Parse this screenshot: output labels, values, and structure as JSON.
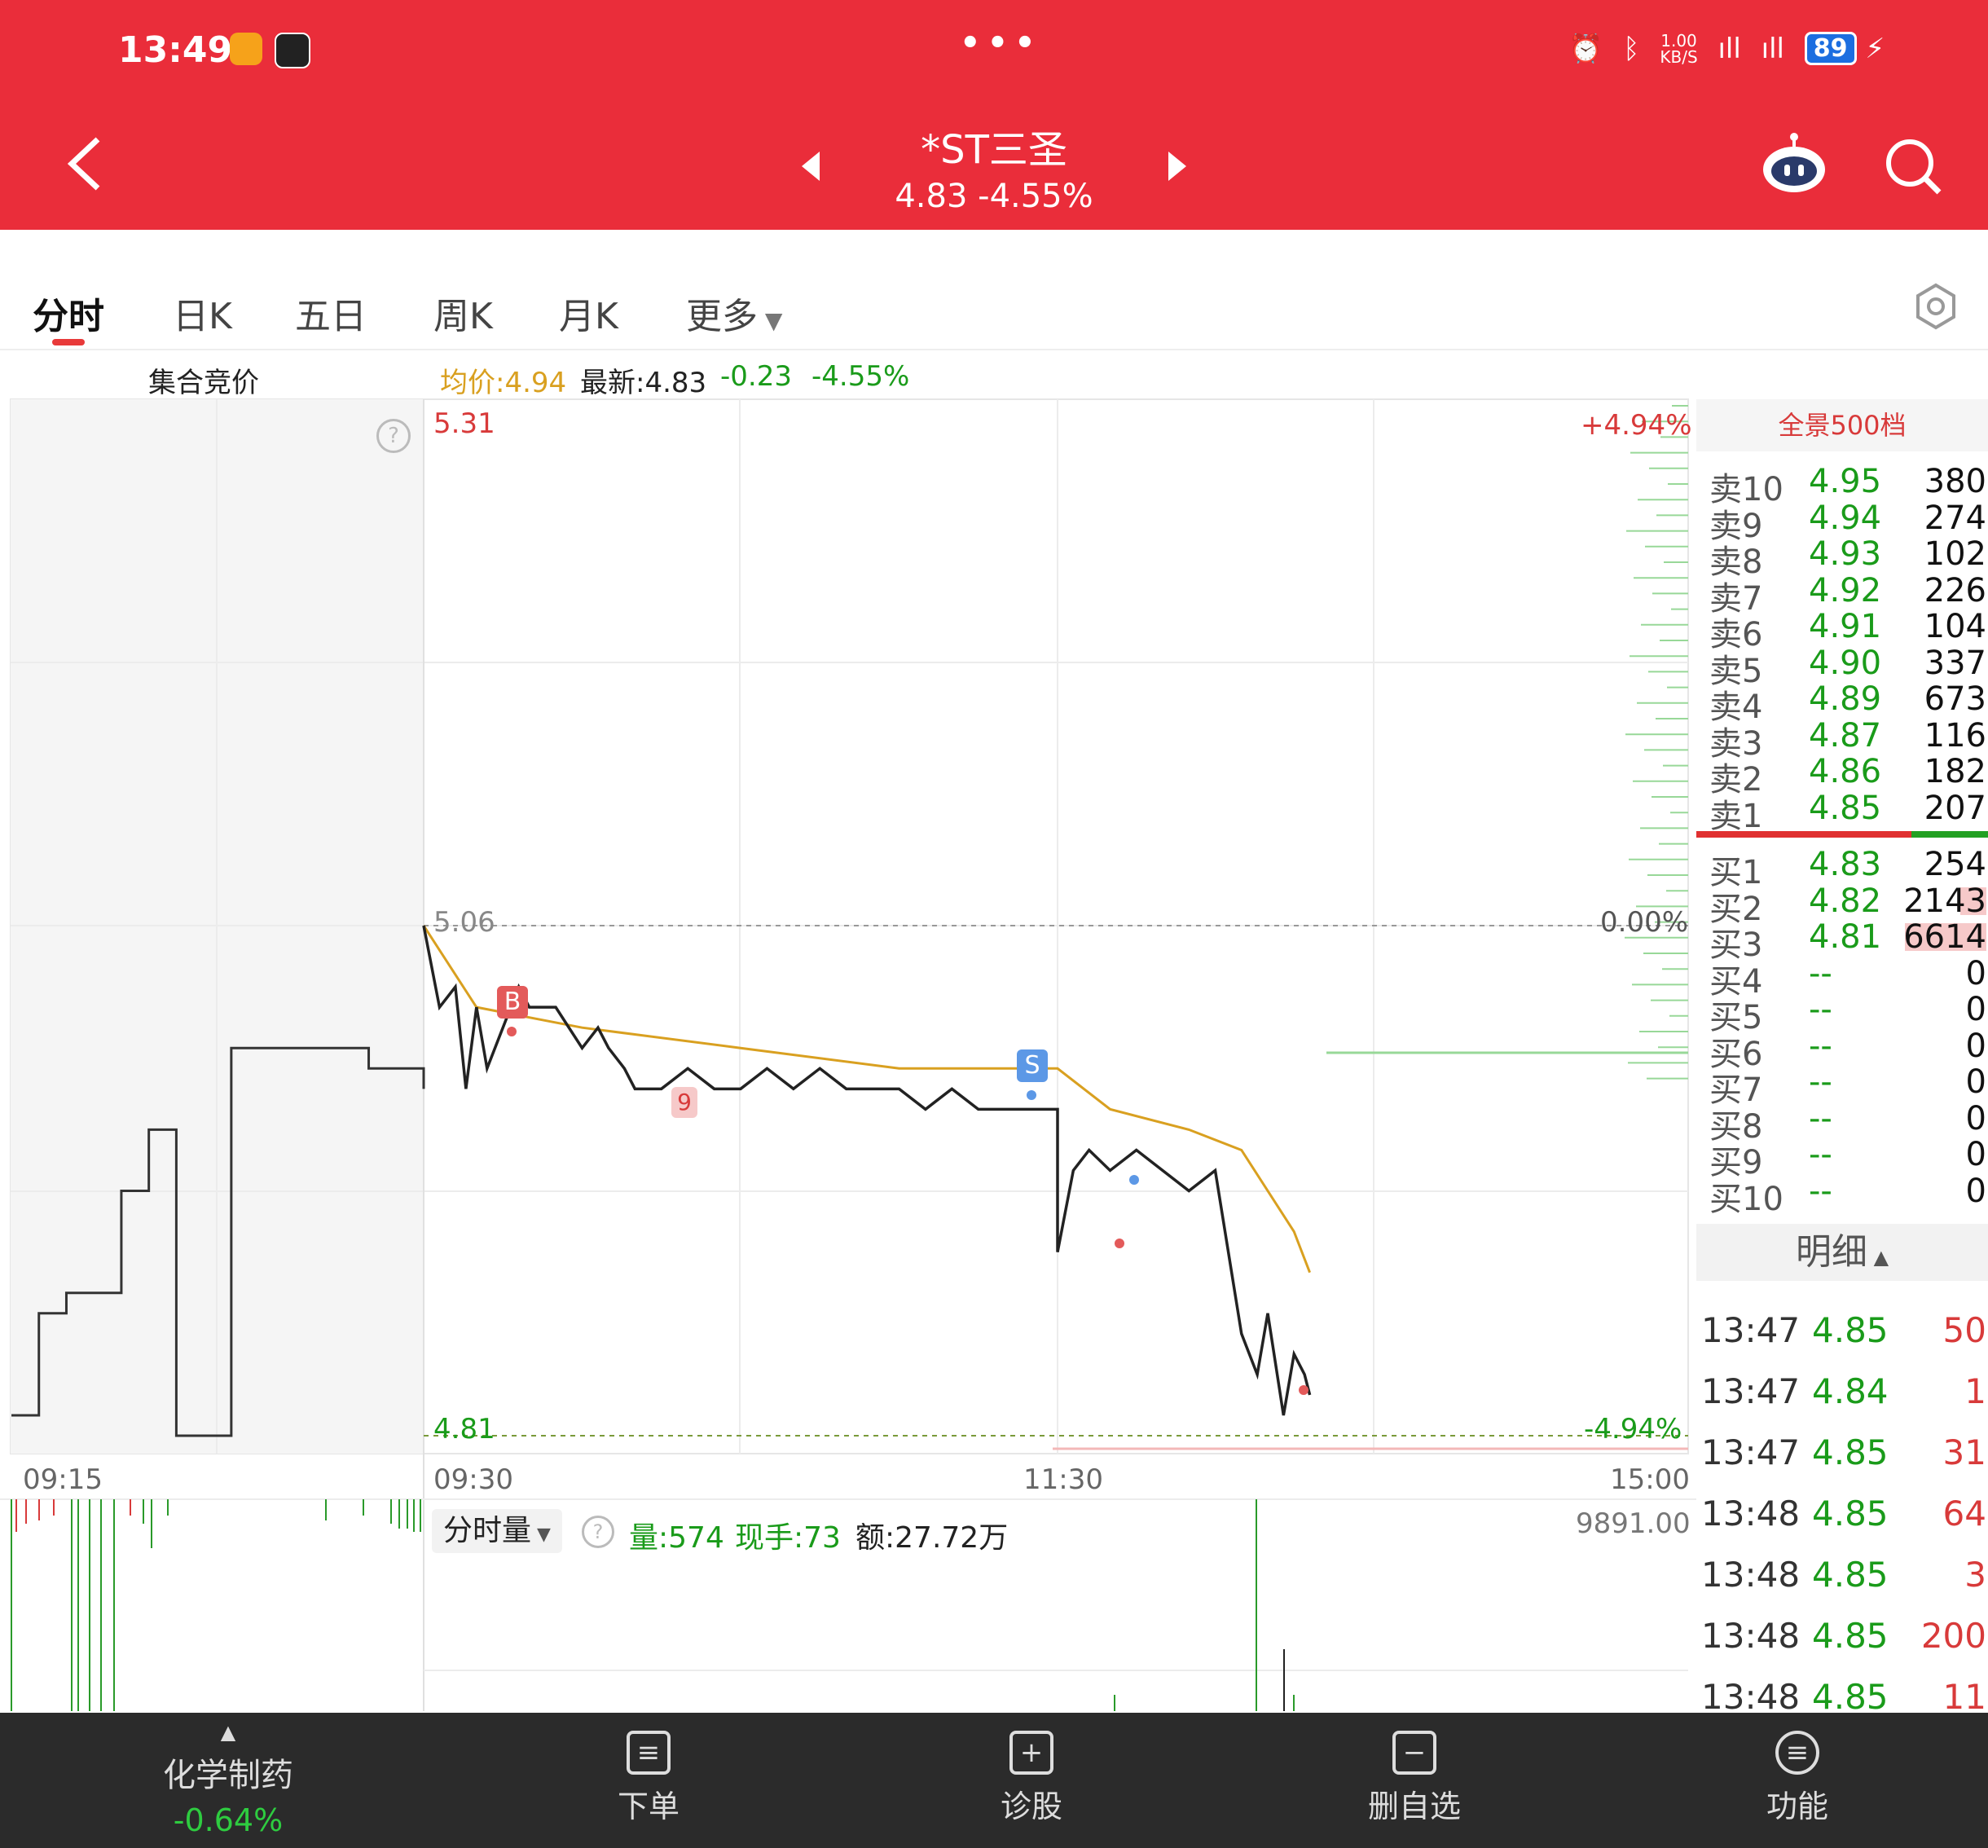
{
  "status_bar": {
    "time": "13:49",
    "net_speed": "1.00\nKB/S",
    "battery": "89"
  },
  "header": {
    "title": "*ST三圣",
    "price": "4.83",
    "change_pct": "-4.55%",
    "subtitle": "4.83 -4.55%"
  },
  "tabs": [
    {
      "label": "分时",
      "active": true
    },
    {
      "label": "日K"
    },
    {
      "label": "五日"
    },
    {
      "label": "周K"
    },
    {
      "label": "月K"
    },
    {
      "label": "更多"
    }
  ],
  "info_line": {
    "auction_label": "集合竞价",
    "avg_price": "均价:4.94",
    "latest": "最新:4.83",
    "change": "-0.23",
    "change_pct": "-4.55%"
  },
  "chart_labels": {
    "high_price": "5.31",
    "high_pct": "+4.94%",
    "base_price": "5.06",
    "base_pct": "0.00%",
    "low_price": "4.81",
    "low_pct": "-4.94%",
    "time_ticks": [
      "09:15",
      "09:30",
      "11:30",
      "15:00"
    ],
    "volume_max": "9891.00"
  },
  "chart_markers": {
    "buy": "B",
    "sell": "S",
    "nine": "9",
    "help": "?"
  },
  "chart_data": {
    "type": "line",
    "ylim": [
      4.81,
      5.31
    ],
    "reference_price": 5.06,
    "series": [
      {
        "x": [
          "09:30",
          "09:33",
          "09:36",
          "09:38",
          "09:40",
          "09:42",
          "09:45",
          "09:48",
          "09:50",
          "09:55",
          "10:00",
          "10:03",
          "10:05",
          "10:08",
          "10:10",
          "10:15",
          "10:20",
          "10:25",
          "10:30",
          "10:35",
          "10:40",
          "10:45",
          "10:50",
          "10:55",
          "11:00",
          "11:05",
          "11:10",
          "11:15",
          "11:20",
          "11:25",
          "11:30",
          "13:00",
          "13:03",
          "13:06",
          "13:10",
          "13:15",
          "13:20",
          "13:25",
          "13:30",
          "13:35",
          "13:38",
          "13:40",
          "13:43",
          "13:45",
          "13:47",
          "13:48"
        ],
        "values": [
          5.06,
          5.02,
          5.03,
          4.98,
          5.02,
          4.99,
          5.01,
          5.03,
          5.02,
          5.02,
          5.0,
          5.01,
          5.0,
          4.99,
          4.98,
          4.98,
          4.99,
          4.98,
          4.98,
          4.99,
          4.98,
          4.99,
          4.98,
          4.98,
          4.98,
          4.97,
          4.98,
          4.97,
          4.97,
          4.97,
          4.97,
          4.9,
          4.94,
          4.95,
          4.94,
          4.95,
          4.94,
          4.93,
          4.94,
          4.86,
          4.84,
          4.87,
          4.82,
          4.85,
          4.84,
          4.83
        ]
      },
      {
        "x": [
          "09:30",
          "09:40",
          "10:00",
          "10:30",
          "11:00",
          "11:30",
          "13:10",
          "13:25",
          "13:35",
          "13:45",
          "13:48"
        ],
        "values": [
          5.06,
          5.02,
          5.01,
          5.0,
          4.99,
          4.99,
          4.97,
          4.96,
          4.95,
          4.91,
          4.89
        ]
      }
    ],
    "auction_segment": {
      "x": [
        "09:15",
        "09:16",
        "09:17",
        "09:19",
        "09:20",
        "09:21",
        "09:23",
        "09:25",
        "09:28",
        "09:30"
      ],
      "values": [
        4.82,
        4.87,
        4.88,
        4.93,
        4.96,
        4.81,
        5.0,
        5.0,
        4.99,
        4.98
      ]
    }
  },
  "volume": {
    "selector": "分时量",
    "qty": "量:574",
    "hand": "现手:73",
    "amount": "额:27.72万"
  },
  "orderbook": {
    "title": "全景500档",
    "asks": [
      {
        "label": "卖10",
        "price": "4.95",
        "vol": "380"
      },
      {
        "label": "卖9",
        "price": "4.94",
        "vol": "274"
      },
      {
        "label": "卖8",
        "price": "4.93",
        "vol": "102"
      },
      {
        "label": "卖7",
        "price": "4.92",
        "vol": "226"
      },
      {
        "label": "卖6",
        "price": "4.91",
        "vol": "104"
      },
      {
        "label": "卖5",
        "price": "4.90",
        "vol": "337"
      },
      {
        "label": "卖4",
        "price": "4.89",
        "vol": "673"
      },
      {
        "label": "卖3",
        "price": "4.87",
        "vol": "116"
      },
      {
        "label": "卖2",
        "price": "4.86",
        "vol": "182"
      },
      {
        "label": "卖1",
        "price": "4.85",
        "vol": "207"
      }
    ],
    "bids": [
      {
        "label": "买1",
        "price": "4.83",
        "vol": "254"
      },
      {
        "label": "买2",
        "price": "4.82",
        "vol": "2143"
      },
      {
        "label": "买3",
        "price": "4.81",
        "vol": "6614"
      },
      {
        "label": "买4",
        "price": "--",
        "vol": "0"
      },
      {
        "label": "买5",
        "price": "--",
        "vol": "0"
      },
      {
        "label": "买6",
        "price": "--",
        "vol": "0"
      },
      {
        "label": "买7",
        "price": "--",
        "vol": "0"
      },
      {
        "label": "买8",
        "price": "--",
        "vol": "0"
      },
      {
        "label": "买9",
        "price": "--",
        "vol": "0"
      },
      {
        "label": "买10",
        "price": "--",
        "vol": "0"
      }
    ],
    "detail_title": "明细",
    "details": [
      {
        "time": "13:47",
        "price": "4.85",
        "vol": "50"
      },
      {
        "time": "13:47",
        "price": "4.84",
        "vol": "1"
      },
      {
        "time": "13:47",
        "price": "4.85",
        "vol": "31"
      },
      {
        "time": "13:48",
        "price": "4.85",
        "vol": "64"
      },
      {
        "time": "13:48",
        "price": "4.85",
        "vol": "3"
      },
      {
        "time": "13:48",
        "price": "4.85",
        "vol": "200"
      },
      {
        "time": "13:48",
        "price": "4.85",
        "vol": "11"
      }
    ]
  },
  "bottom_nav": {
    "sector_name": "化学制药",
    "sector_change": "-0.64%",
    "items": [
      {
        "label": "下单",
        "icon": "order-icon"
      },
      {
        "label": "诊股",
        "icon": "diagnose-icon"
      },
      {
        "label": "删自选",
        "icon": "remove-watchlist-icon"
      },
      {
        "label": "功能",
        "icon": "menu-icon"
      }
    ]
  },
  "colors": {
    "header_red": "#ea2d3a",
    "up_red": "#d83a3a",
    "down_green": "#1a9b1a",
    "avg_line": "#d9a020"
  }
}
